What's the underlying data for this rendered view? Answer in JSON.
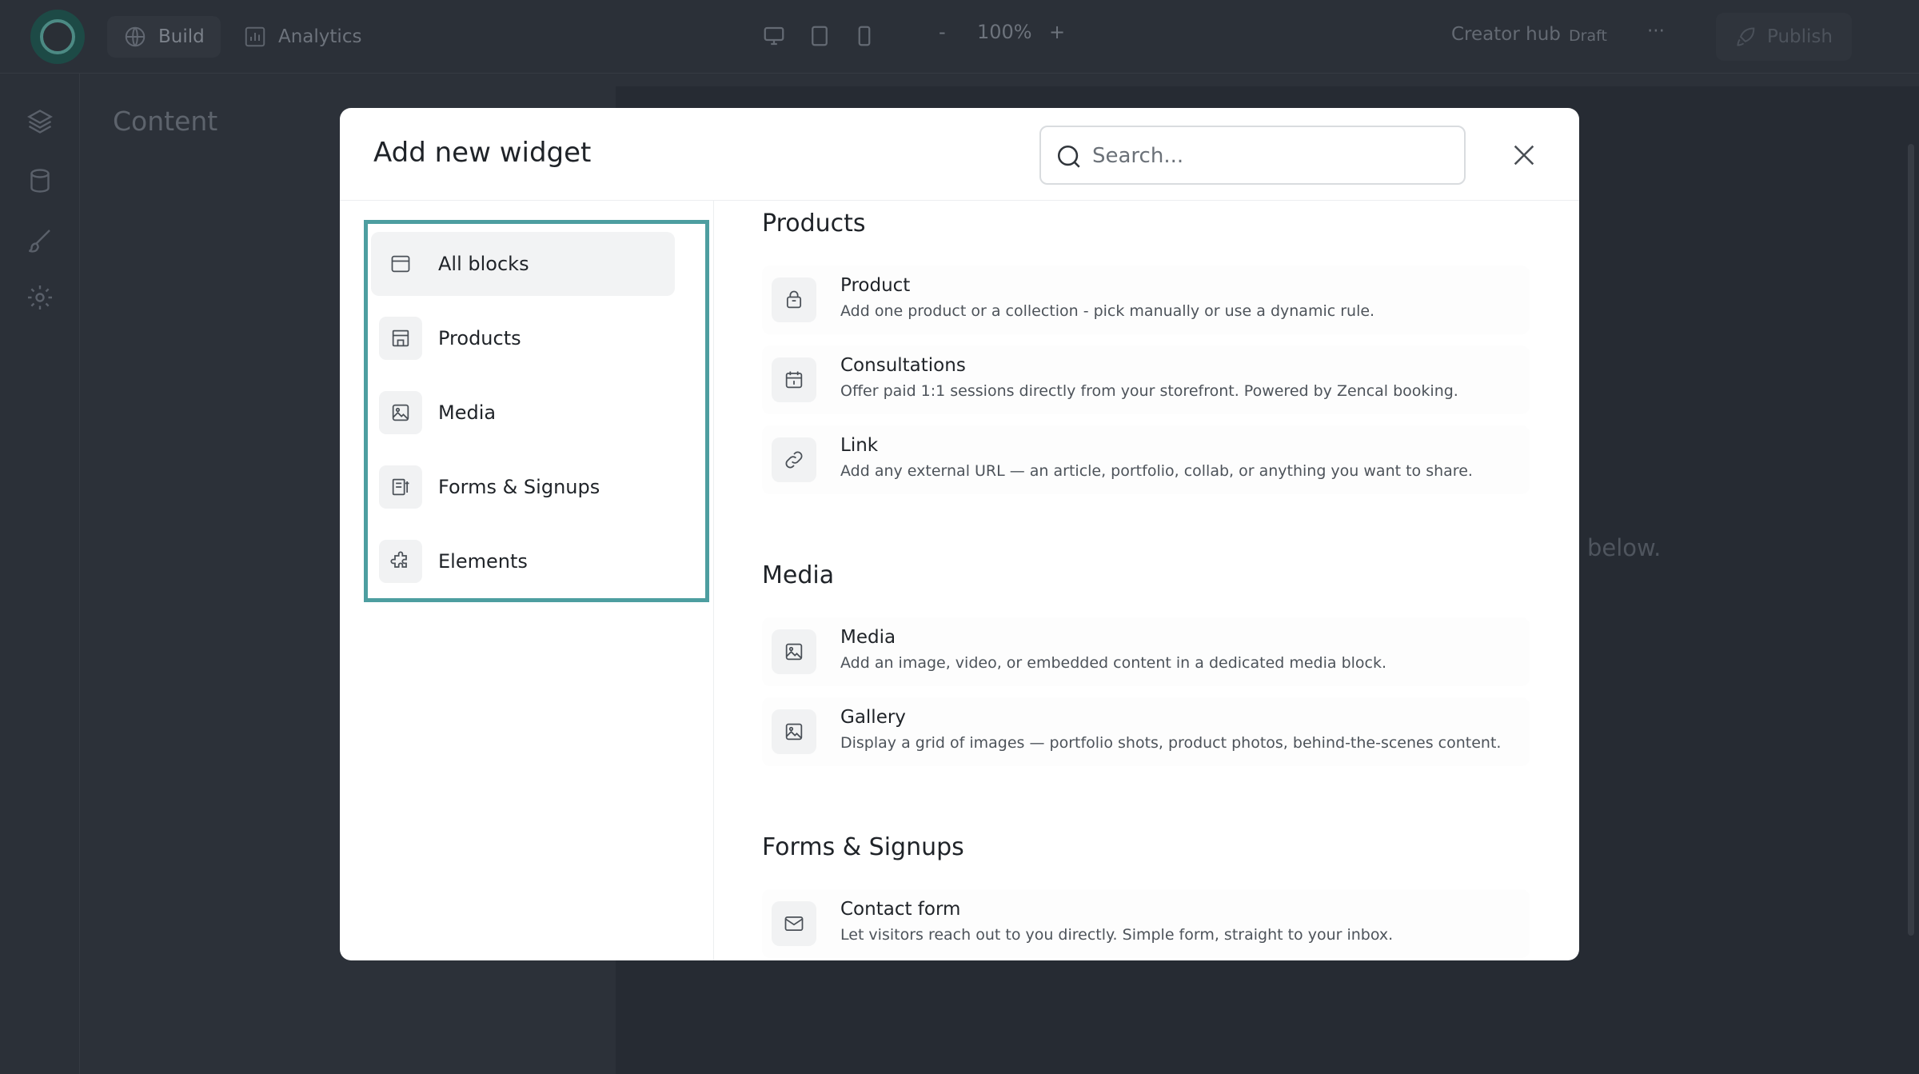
{
  "topbar": {
    "tabs": [
      {
        "label": "Build",
        "icon": "globe-icon"
      },
      {
        "label": "Analytics",
        "icon": "bar-chart-icon"
      }
    ],
    "zoom_minus": "-",
    "zoom_value": "100%",
    "zoom_plus": "+",
    "site_name": "Creator hub",
    "status": "Draft",
    "more": "···",
    "publish_label": "Publish"
  },
  "content_panel": {
    "title": "Content"
  },
  "canvas": {
    "hint_text": "below."
  },
  "modal": {
    "title": "Add new widget",
    "search_placeholder": "Search...",
    "nav": [
      {
        "label": "All blocks",
        "icon": "layout-icon",
        "selected": true
      },
      {
        "label": "Products",
        "icon": "store-icon"
      },
      {
        "label": "Media",
        "icon": "image-icon"
      },
      {
        "label": "Forms & Signups",
        "icon": "form-icon"
      },
      {
        "label": "Elements",
        "icon": "puzzle-icon"
      }
    ],
    "sections": [
      {
        "title": "Products",
        "widgets": [
          {
            "name": "Product",
            "icon": "shopping-bag-icon",
            "description": "Add one product or a collection - pick manually or use a dynamic rule."
          },
          {
            "name": "Consultations",
            "icon": "calendar-icon",
            "description": "Offer paid 1:1 sessions directly from your storefront. Powered by Zencal booking."
          },
          {
            "name": "Link",
            "icon": "link-icon",
            "description": "Add any external URL — an article, portfolio, collab, or anything you want to share."
          }
        ]
      },
      {
        "title": "Media",
        "widgets": [
          {
            "name": "Media",
            "icon": "image-icon",
            "description": "Add an image, video, or embedded content in a dedicated media block."
          },
          {
            "name": "Gallery",
            "icon": "image-icon",
            "description": "Display a grid of images — portfolio shots, product photos, behind-the-scenes content."
          }
        ]
      },
      {
        "title": "Forms & Signups",
        "widgets": [
          {
            "name": "Contact form",
            "icon": "mail-icon",
            "description": "Let visitors reach out to you directly. Simple form, straight to your inbox."
          }
        ]
      }
    ]
  },
  "colors": {
    "accent_frame": "#4d9ea0",
    "backdrop": "#2c3139"
  }
}
